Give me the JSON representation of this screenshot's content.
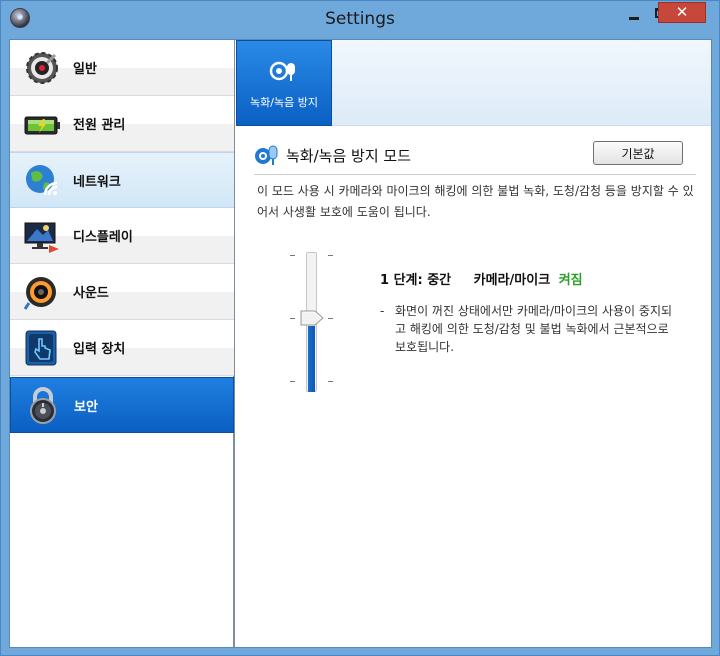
{
  "window": {
    "title": "Settings",
    "close_glyph": "✕"
  },
  "sidebar": {
    "items": [
      {
        "label": "일반",
        "icon": "speaker-gear-icon"
      },
      {
        "label": "전원 관리",
        "icon": "battery-icon"
      },
      {
        "label": "네트워크",
        "icon": "globe-wifi-icon"
      },
      {
        "label": "디스플레이",
        "icon": "monitor-icon"
      },
      {
        "label": "사운드",
        "icon": "speaker-icon"
      },
      {
        "label": "입력 장치",
        "icon": "touch-hand-icon"
      },
      {
        "label": "보안",
        "icon": "padlock-icon"
      }
    ],
    "hover_index": 2,
    "active_index": 6
  },
  "main": {
    "tab_label": "녹화/녹음 방지",
    "section_title": "녹화/녹음 방지 모드",
    "default_button": "기본값",
    "description": "이 모드 사용 시 카메라와 마이크의 해킹에 의한 불법 녹화, 도청/감청 등을 방지할 수 있어서 사생활 보호에 도움이 됩니다.",
    "level": {
      "label": "1 단계: 중간",
      "device": "카메라/마이크",
      "state": "켜짐",
      "state_color": "#2aa02a"
    },
    "note_dash": "-",
    "note": "화면이 꺼진 상태에서만 카메라/마이크의 사용이 중지되고 해킹에 의한 도청/감청 및 불법 녹화에서 근본적으로 보호됩니다.",
    "slider": {
      "steps": 3,
      "selected_step": 1
    }
  },
  "colors": {
    "accent": "#0b60c4",
    "titlebar": "#6fa9dc",
    "close": "#c7473a"
  }
}
